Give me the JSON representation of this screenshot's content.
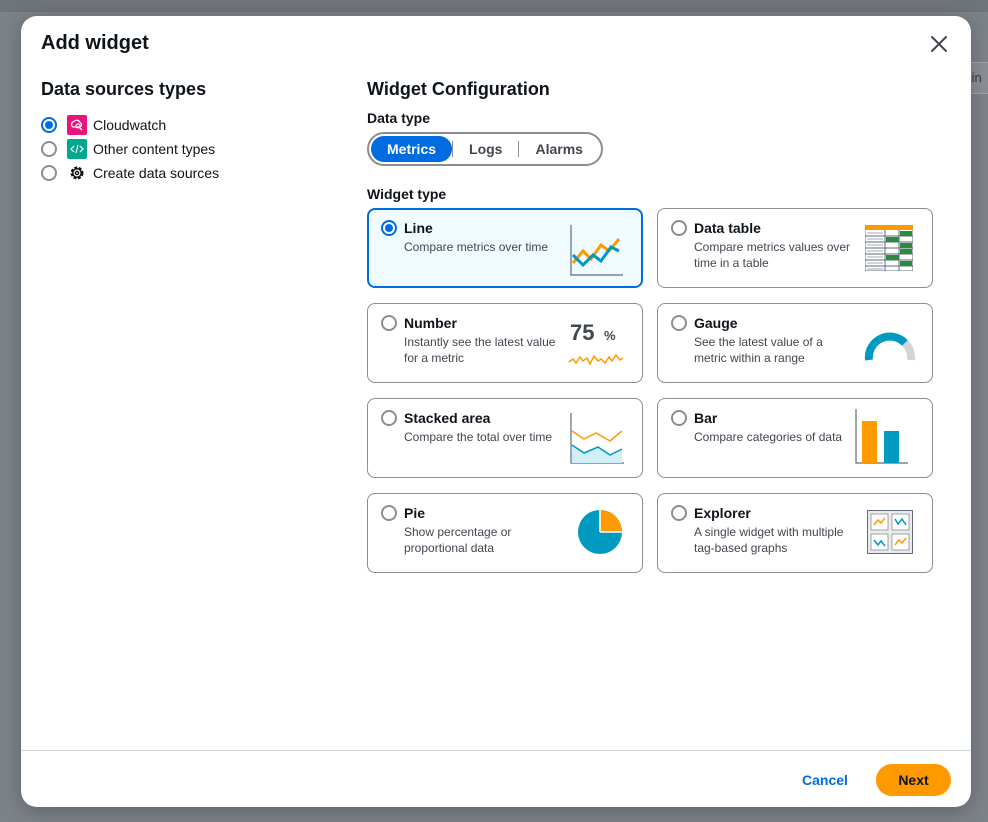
{
  "modal": {
    "title": "Add widget"
  },
  "data_sources": {
    "title": "Data sources types",
    "items": [
      {
        "label": "Cloudwatch",
        "selected": true,
        "icon": "cloudwatch-icon"
      },
      {
        "label": "Other content types",
        "selected": false,
        "icon": "code-icon"
      },
      {
        "label": "Create data sources",
        "selected": false,
        "icon": "gear-icon"
      }
    ]
  },
  "config": {
    "title": "Widget Configuration",
    "data_type_label": "Data type",
    "data_types": [
      "Metrics",
      "Logs",
      "Alarms"
    ],
    "data_type_selected": "Metrics",
    "widget_type_label": "Widget type",
    "widgets": [
      {
        "title": "Line",
        "desc": "Compare metrics over time",
        "selected": true,
        "icon": "line-chart-icon"
      },
      {
        "title": "Data table",
        "desc": "Compare metrics values over time in a table",
        "selected": false,
        "icon": "data-table-icon"
      },
      {
        "title": "Number",
        "desc": "Instantly see the latest value for a metric",
        "selected": false,
        "icon": "number-icon",
        "sample_value": "75",
        "sample_unit": "%"
      },
      {
        "title": "Gauge",
        "desc": "See the latest value of a metric within a range",
        "selected": false,
        "icon": "gauge-icon"
      },
      {
        "title": "Stacked area",
        "desc": "Compare the total over time",
        "selected": false,
        "icon": "stacked-area-icon"
      },
      {
        "title": "Bar",
        "desc": "Compare categories of data",
        "selected": false,
        "icon": "bar-chart-icon"
      },
      {
        "title": "Pie",
        "desc": "Show percentage or proportional data",
        "selected": false,
        "icon": "pie-chart-icon"
      },
      {
        "title": "Explorer",
        "desc": "A single widget with multiple tag-based graphs",
        "selected": false,
        "icon": "explorer-icon"
      }
    ]
  },
  "footer": {
    "cancel_label": "Cancel",
    "next_label": "Next"
  },
  "background": {
    "tab_text": "tin"
  },
  "colors": {
    "primary": "#006ce0",
    "accent": "#ff9900",
    "chart_blue": "#0099c0",
    "chart_orange": "#ff9900"
  }
}
